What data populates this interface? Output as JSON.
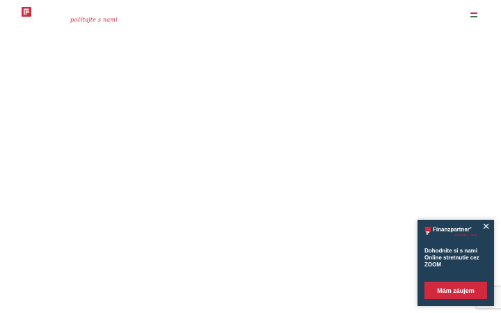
{
  "header": {
    "logo_icon": "finanzpartner-logo-icon",
    "tagline": "počítajte s nami",
    "language_flag": "hungarian-flag-icon"
  },
  "popup": {
    "brand_name": "Finanzpartner",
    "brand_mark": "®",
    "brand_tagline": "počítajte s nami",
    "text_lines": [
      "Dohodnite si s nami",
      "Online stretnutie cez",
      "ZOOM"
    ],
    "button_label": "Mám záujem",
    "close_icon": "close-icon"
  },
  "colors": {
    "brand_red": "#d2293f",
    "popup_bg": "#213f56",
    "page_bg": "#ffffff"
  }
}
